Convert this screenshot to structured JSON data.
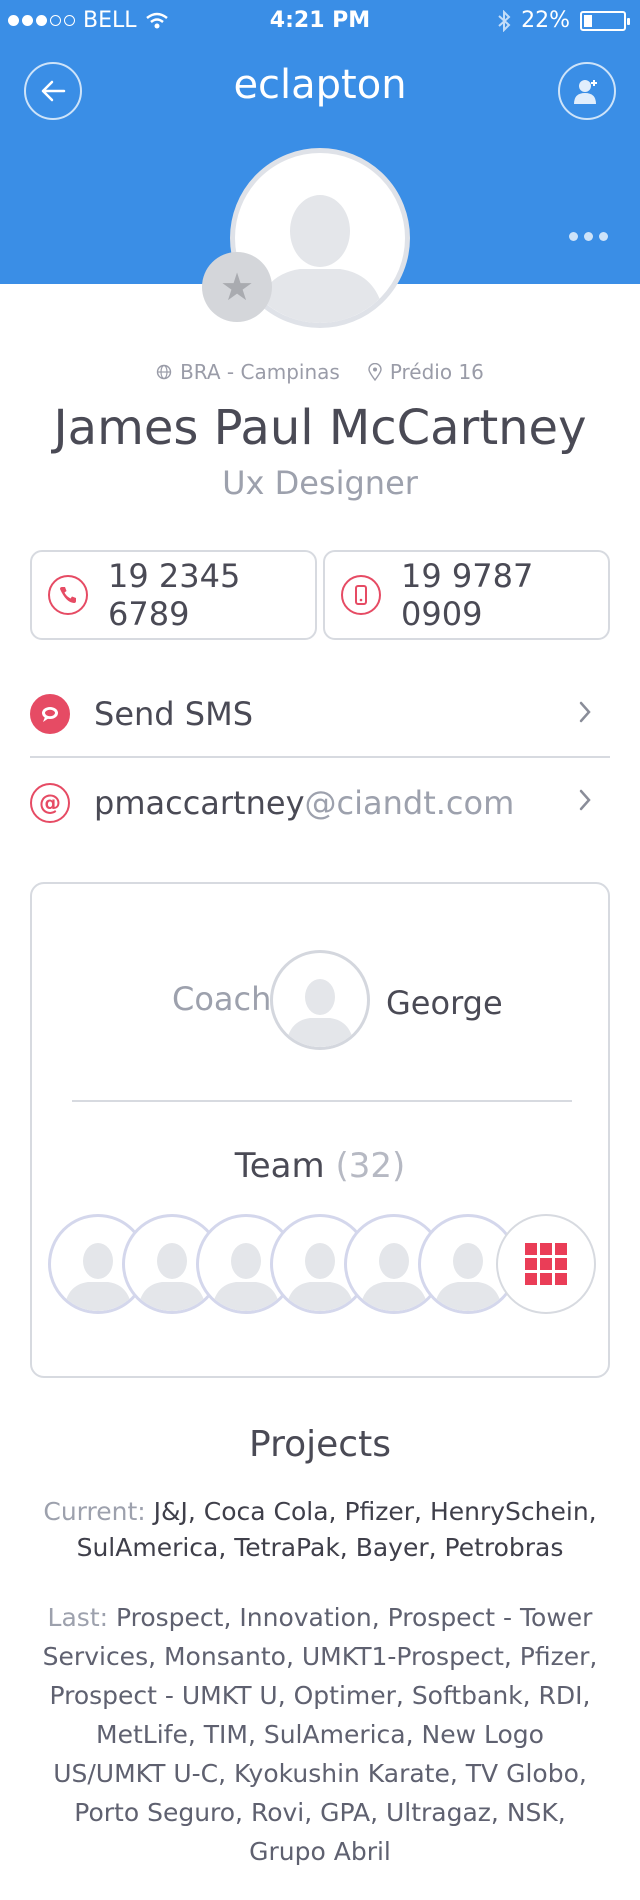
{
  "status_bar": {
    "carrier": "BELL",
    "time": "4:21 PM",
    "battery": "22%",
    "battery_level": 0.22
  },
  "nav": {
    "title": "eclapton"
  },
  "profile": {
    "location": "BRA - Campinas",
    "building": "Prédio 16",
    "name": "James Paul McCartney",
    "role": "Ux Designer"
  },
  "phones": {
    "landline": "19 2345 6789",
    "mobile": "19 9787 0909"
  },
  "actions": {
    "sms_label": "Send SMS",
    "email_user": "pmaccartney",
    "email_domain": "@ciandt.com"
  },
  "coach": {
    "label": "Coach",
    "name": "George"
  },
  "team": {
    "label": "Team",
    "count": "(32)"
  },
  "projects": {
    "title": "Projects",
    "current_label": "Current:",
    "current": "J&J, Coca Cola, Pfizer, HenrySchein, SulAmerica, TetraPak, Bayer, Petrobras",
    "last_label": "Last:",
    "last": "Prospect, Innovation, Prospect - Tower Services, Monsanto, UMKT1-Prospect, Pfizer, Prospect - UMKT U, Optimer, Softbank, RDI, MetLife, TIM, SulAmerica, New Logo US/UMKT U-C, Kyokushin Karate, TV Globo, Porto Seguro, Rovi, GPA, Ultragaz, NSK, Grupo Abril"
  },
  "colors": {
    "header_blue": "#3a8ee6",
    "accent_red": "#e64b64",
    "border": "#d7dae0"
  }
}
